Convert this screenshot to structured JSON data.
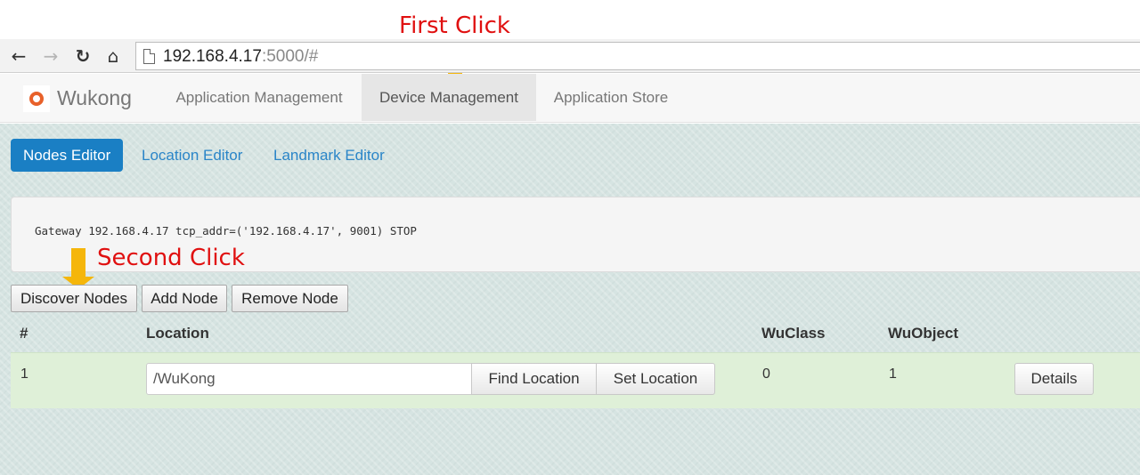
{
  "annotations": {
    "first_click": "First Click",
    "second_click": "Second Click",
    "arrow_color": "#f5b60a",
    "text_color": "#e01010"
  },
  "browser": {
    "back_icon": "back-arrow-icon",
    "forward_icon": "forward-arrow-icon",
    "reload_icon": "reload-icon",
    "home_icon": "home-icon",
    "url_host": "192.168.4.17",
    "url_rest": ":5000/#"
  },
  "navbar": {
    "brand": "Wukong",
    "brand_color": "#e8612a",
    "items": [
      {
        "label": "Application Management"
      },
      {
        "label": "Device Management",
        "active": true
      },
      {
        "label": "Application Store"
      }
    ]
  },
  "subnav": {
    "items": [
      {
        "label": "Nodes Editor",
        "active": true
      },
      {
        "label": "Location Editor"
      },
      {
        "label": "Landmark Editor"
      }
    ],
    "active_color": "#1a7fc4"
  },
  "gateway": {
    "text": "Gateway 192.168.4.17 tcp_addr=('192.168.4.17', 9001) STOP"
  },
  "actions": {
    "discover": "Discover Nodes",
    "add": "Add Node",
    "remove": "Remove Node"
  },
  "table": {
    "headers": [
      "#",
      "Location",
      "WuClass",
      "WuObject"
    ],
    "rows": [
      {
        "id": "1",
        "location": "/WuKong",
        "find_label": "Find Location",
        "set_label": "Set Location",
        "wuclass": "0",
        "wuobject": "1",
        "details_label": "Details"
      }
    ]
  }
}
